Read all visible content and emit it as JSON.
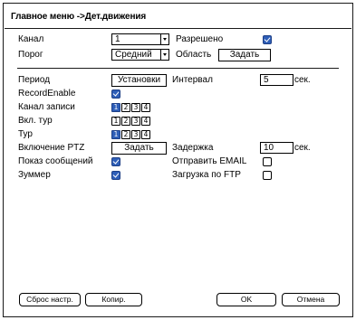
{
  "title": "Главное меню ->Дет.движения",
  "top": {
    "channel_label": "Канал",
    "channel_value": "1",
    "enabled_label": "Разрешено",
    "enabled_checked": true,
    "threshold_label": "Порог",
    "threshold_value": "Средний",
    "area_label": "Область",
    "area_button": "Задать"
  },
  "main": {
    "period_label": "Период",
    "period_button": "Установки",
    "interval_label": "Интервал",
    "interval_value": "5",
    "interval_unit": "сек.",
    "record_enable_label": "RecordEnable",
    "record_enable_checked": true,
    "record_channel_label": "Канал записи",
    "record_channels": [
      {
        "label": "1",
        "on": true
      },
      {
        "label": "2",
        "on": false
      },
      {
        "label": "3",
        "on": false
      },
      {
        "label": "4",
        "on": false
      }
    ],
    "tour_enable_label": "Вкл. тур",
    "tour_enable_channels": [
      {
        "label": "1",
        "on": false
      },
      {
        "label": "2",
        "on": false
      },
      {
        "label": "3",
        "on": false
      },
      {
        "label": "4",
        "on": false
      }
    ],
    "tour_label": "Тур",
    "tour_channels": [
      {
        "label": "1",
        "on": true
      },
      {
        "label": "2",
        "on": false
      },
      {
        "label": "3",
        "on": false
      },
      {
        "label": "4",
        "on": false
      }
    ],
    "ptz_label": "Включение PTZ",
    "ptz_button": "Задать",
    "delay_label": "Задержка",
    "delay_value": "10",
    "delay_unit": "сек.",
    "show_message_label": "Показ сообщений",
    "show_message_checked": true,
    "send_email_label": "Отправить EMAIL",
    "send_email_checked": false,
    "buzzer_label": "Зуммер",
    "buzzer_checked": true,
    "ftp_upload_label": "Загрузка по FTP",
    "ftp_upload_checked": false
  },
  "footer": {
    "reset_button": "Сброс настр.",
    "copy_button": "Копир.",
    "ok_button": "OK",
    "cancel_button": "Отмена"
  },
  "colors": {
    "checked_fill": "#2f5fb8",
    "border": "#1a1a1a"
  }
}
